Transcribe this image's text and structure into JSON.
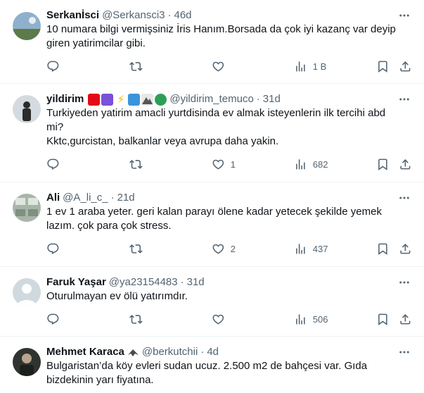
{
  "tweets": [
    {
      "name": "Serkanİsci",
      "handle": "@Serkansci3",
      "dot": "·",
      "time": "46d",
      "text": "10 numara bilgi vermişsiniz İris Hanım.Borsada da çok iyi kazanç var deyip giren yatirimcilar gibi.",
      "likes": "",
      "views": "1 B",
      "avatar_colors": [
        "#7a9bb8",
        "#5d7a4a"
      ]
    },
    {
      "name": "yildirim",
      "handle": "@yildirim_temuco",
      "dot": "·",
      "time": "31d",
      "text": "Turkiyeden yatirim amacli yurtdisinda ev almak isteyenlerin ilk tercihi abd mi?\nKktc,gurcistan, balkanlar veya avrupa daha yakin.",
      "likes": "1",
      "views": "682",
      "avatar_colors": [
        "#c9d3dc",
        "#2b2b2b"
      ],
      "emojis": [
        "flag-turkey",
        "crescent-purple",
        "lightning",
        "wave",
        "mountain",
        "globe"
      ]
    },
    {
      "name": "Ali",
      "handle": "@A_li_c_",
      "dot": "·",
      "time": "21d",
      "text": "1 ev 1 araba yeter. geri kalan parayı ölene kadar yetecek şekilde yemek lazım. çok para çok stress.",
      "likes": "2",
      "views": "437",
      "avatar_colors": [
        "#9fb0a0",
        "#6f7f70"
      ]
    },
    {
      "name": "Faruk Yaşar",
      "handle": "@ya23154483",
      "dot": "·",
      "time": "31d",
      "text": "Oturulmayan ev ölü yatırımdır.",
      "likes": "",
      "views": "506",
      "avatar_colors": [
        "#cfd9de",
        "#ffffff"
      ]
    },
    {
      "name": "Mehmet Karaca",
      "handle": "@berkutchii",
      "dot": "·",
      "time": "4d",
      "text": "Bulgaristan’da köy evleri sudan ucuz. 2.500 m2 de bahçesi var. Gıda bizdekinin yarı fiyatına.",
      "likes": "",
      "views": "",
      "avatar_colors": [
        "#3a3f3a",
        "#c2c8bf"
      ],
      "emojis": [
        "eagle"
      ]
    }
  ],
  "colors": {
    "text": "#0f1419",
    "secondary": "#536471",
    "border": "#eff3f4"
  },
  "icons": [
    "reply-icon",
    "retweet-icon",
    "like-icon",
    "views-icon",
    "bookmark-icon",
    "share-icon",
    "more-icon"
  ]
}
